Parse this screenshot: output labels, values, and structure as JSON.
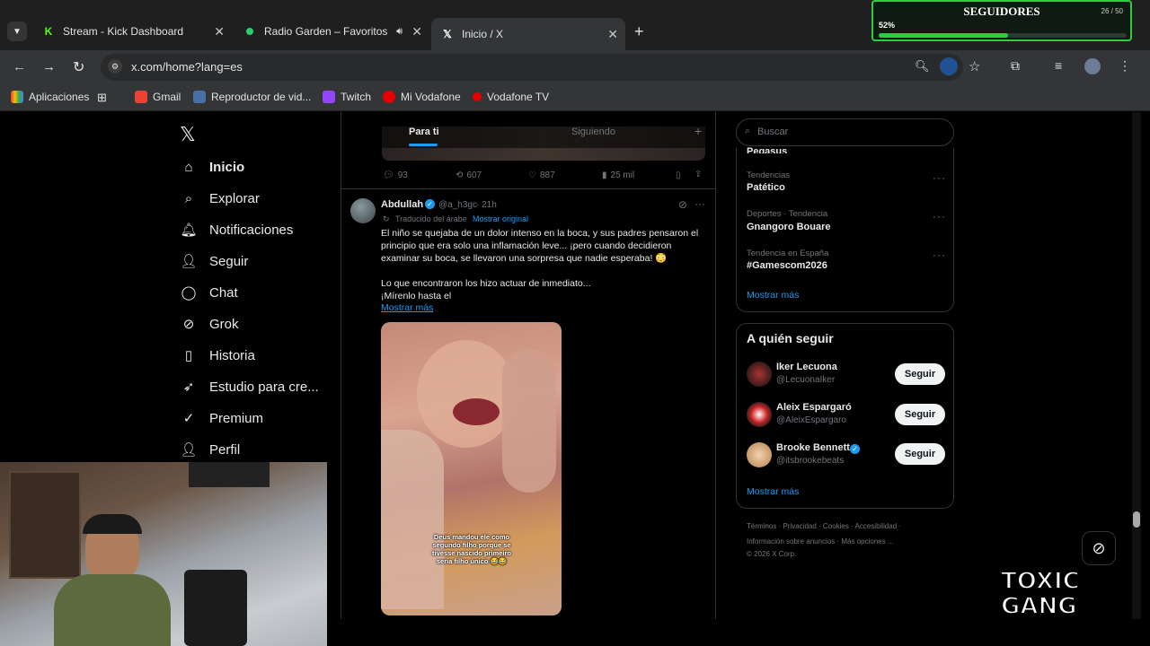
{
  "browser": {
    "tabs": [
      {
        "label": "Stream - Kick Dashboard",
        "icon": "kick-icon"
      },
      {
        "label": "Radio Garden – Favoritos",
        "icon": "radio-garden-icon"
      },
      {
        "label": "Inicio / X",
        "icon": "x-logo-icon"
      }
    ],
    "url": "x.com/home?lang=es",
    "bookmarks": [
      "Aplicaciones",
      "Gmail",
      "Reproductor de vid...",
      "Twitch",
      "Mi Vodafone",
      "Vodafone TV"
    ]
  },
  "overlay": {
    "followers_title": "SEGUIDORES",
    "followers_count": "26 / 50",
    "followers_percent_label": "52%",
    "followers_progress": 0.52,
    "logo_text": "TOXIC GANG"
  },
  "x_nav": {
    "items": [
      "Inicio",
      "Explorar",
      "Notificaciones",
      "Seguir",
      "Chat",
      "Grok",
      "Historia",
      "Estudio para cre...",
      "Premium",
      "Perfil"
    ]
  },
  "feed": {
    "tabs": [
      "Para ti",
      "Siguiendo"
    ],
    "prev_tweet_stats": {
      "replies": "93",
      "retweets": "607",
      "likes": "887",
      "views": "25 mil"
    },
    "tweet": {
      "author": "Abdullah",
      "handle": "@a_h3gc",
      "time": "· 21h",
      "translated_note": "Traducido del árabe",
      "show_original": "Mostrar original",
      "text1": "El niño se quejaba de un dolor intenso en la boca, y sus padres pensaron el principio que era solo una inflamación leve... ¡pero cuando decidieron examinar su boca, se llevaron una sorpresa que nadie esperaba! 😳",
      "text2": "Lo que encontraron los hizo actuar de inmediato...",
      "text3": "¡Mírenlo hasta el",
      "show_more": "Mostrar más",
      "media_caption": "Deus mandou ele como segundo filho porque se tivesse nascido primeiro seria filho único 😂😂"
    }
  },
  "sidebar": {
    "search_placeholder": "Buscar",
    "partial_trend": "Pegasus",
    "trends": [
      {
        "category": "Tendencias",
        "name": "Patético"
      },
      {
        "category": "Deportes · Tendencia",
        "name": "Gnangoro Bouare"
      },
      {
        "category": "Tendencia en España",
        "name": "#Gamescom2026"
      }
    ],
    "show_more": "Mostrar más",
    "who_to_follow_title": "A quién seguir",
    "who_to_follow": [
      {
        "name": "Iker Lecuona",
        "handle": "@LecuonaIker",
        "button": "Seguir"
      },
      {
        "name": "Aleix Espargaró",
        "handle": "@AleixEspargaro",
        "button": "Seguir"
      },
      {
        "name": "Brooke Bennett",
        "handle": "@itsbrookebeats",
        "button": "Seguir"
      }
    ],
    "wtf_show_more": "Mostrar más",
    "footer_line1": [
      "Términos",
      "Privacidad",
      "Cookies",
      "Accesibilidad"
    ],
    "footer_line2": [
      "Información sobre anuncios",
      "Más opciones ..."
    ],
    "copyright": "© 2026 X Corp."
  },
  "colors": {
    "accent": "#1d9bf0",
    "progress": "#2ecc40",
    "kick": "#53fc18"
  }
}
